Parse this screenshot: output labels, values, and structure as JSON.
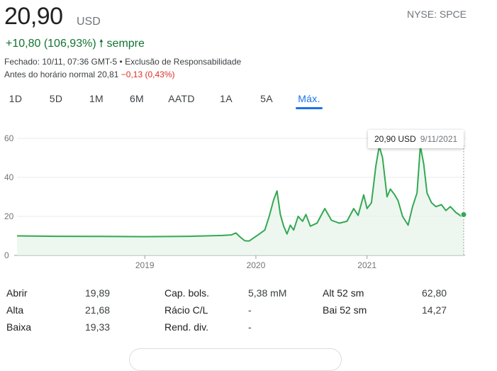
{
  "quote": {
    "price": "20,90",
    "currency": "USD",
    "ticker": "NYSE: SPCE",
    "change": "+10,80 (106,93%)",
    "change_arrow": "🠕",
    "change_period": "sempre",
    "closed_text": "Fechado: 10/11, 07:36 GMT-5 •",
    "disclaimer_link": "Exclusão de Responsabilidade",
    "premarket_label": "Antes do horário normal 20,81",
    "premarket_change": "−0,13 (0,43%)"
  },
  "tabs": [
    {
      "label": "1D",
      "active": false
    },
    {
      "label": "5D",
      "active": false
    },
    {
      "label": "1M",
      "active": false
    },
    {
      "label": "6M",
      "active": false
    },
    {
      "label": "AATD",
      "active": false
    },
    {
      "label": "1A",
      "active": false
    },
    {
      "label": "5A",
      "active": false
    },
    {
      "label": "Máx.",
      "active": true
    }
  ],
  "tooltip": {
    "price": "20,90 USD",
    "date": "9/11/2021"
  },
  "colors": {
    "line": "#34a853",
    "fill": "#e6f4ea",
    "positive": "#137333",
    "negative": "#d93025",
    "accent": "#1a73e8"
  },
  "chart_data": {
    "type": "area",
    "ylim": [
      0,
      60
    ],
    "y_ticks": [
      "0",
      "20",
      "40",
      "60"
    ],
    "x_ticks": [
      "2019",
      "2020",
      "2021"
    ],
    "x_tick_years": [
      2019,
      2020,
      2021
    ],
    "x_range_years": [
      2017.85,
      2021.87
    ],
    "grid": true,
    "series": [
      {
        "points": [
          [
            2017.85,
            10.0
          ],
          [
            2018.2,
            9.8
          ],
          [
            2018.6,
            9.7
          ],
          [
            2019.0,
            9.6
          ],
          [
            2019.4,
            9.8
          ],
          [
            2019.7,
            10.2
          ],
          [
            2019.78,
            10.5
          ],
          [
            2019.82,
            11.5
          ],
          [
            2019.86,
            9.3
          ],
          [
            2019.9,
            7.5
          ],
          [
            2019.94,
            7.4
          ],
          [
            2019.98,
            9.0
          ],
          [
            2020.02,
            10.5
          ],
          [
            2020.08,
            13.0
          ],
          [
            2020.12,
            20.0
          ],
          [
            2020.16,
            28.5
          ],
          [
            2020.19,
            33.0
          ],
          [
            2020.22,
            21.0
          ],
          [
            2020.25,
            15.0
          ],
          [
            2020.28,
            11.0
          ],
          [
            2020.31,
            15.5
          ],
          [
            2020.34,
            13.0
          ],
          [
            2020.38,
            20.0
          ],
          [
            2020.42,
            17.5
          ],
          [
            2020.45,
            21.0
          ],
          [
            2020.49,
            15.0
          ],
          [
            2020.55,
            16.5
          ],
          [
            2020.62,
            24.0
          ],
          [
            2020.68,
            18.0
          ],
          [
            2020.75,
            16.5
          ],
          [
            2020.82,
            17.5
          ],
          [
            2020.88,
            24.0
          ],
          [
            2020.92,
            20.5
          ],
          [
            2020.97,
            31.0
          ],
          [
            2021.0,
            24.0
          ],
          [
            2021.04,
            27.0
          ],
          [
            2021.08,
            46.0
          ],
          [
            2021.11,
            56.0
          ],
          [
            2021.14,
            50.0
          ],
          [
            2021.18,
            30.0
          ],
          [
            2021.21,
            34.0
          ],
          [
            2021.25,
            31.0
          ],
          [
            2021.28,
            28.0
          ],
          [
            2021.32,
            20.0
          ],
          [
            2021.37,
            15.5
          ],
          [
            2021.41,
            25.0
          ],
          [
            2021.45,
            32.0
          ],
          [
            2021.48,
            56.0
          ],
          [
            2021.51,
            47.0
          ],
          [
            2021.54,
            32.0
          ],
          [
            2021.58,
            27.0
          ],
          [
            2021.62,
            25.0
          ],
          [
            2021.67,
            26.0
          ],
          [
            2021.71,
            23.0
          ],
          [
            2021.75,
            25.0
          ],
          [
            2021.8,
            22.0
          ],
          [
            2021.85,
            20.0
          ],
          [
            2021.87,
            20.9
          ]
        ]
      }
    ]
  },
  "stats": {
    "col1": [
      {
        "label": "Abrir",
        "value": "19,89"
      },
      {
        "label": "Alta",
        "value": "21,68"
      },
      {
        "label": "Baixa",
        "value": "19,33"
      }
    ],
    "col2": [
      {
        "label": "Cap. bols.",
        "value": "5,38 mM"
      },
      {
        "label": "Rácio C/L",
        "value": "-"
      },
      {
        "label": "Rend. div.",
        "value": "-"
      }
    ],
    "col3": [
      {
        "label": "Alt 52 sm",
        "value": "62,80"
      },
      {
        "label": "Bai 52 sm",
        "value": "14,27"
      }
    ]
  }
}
